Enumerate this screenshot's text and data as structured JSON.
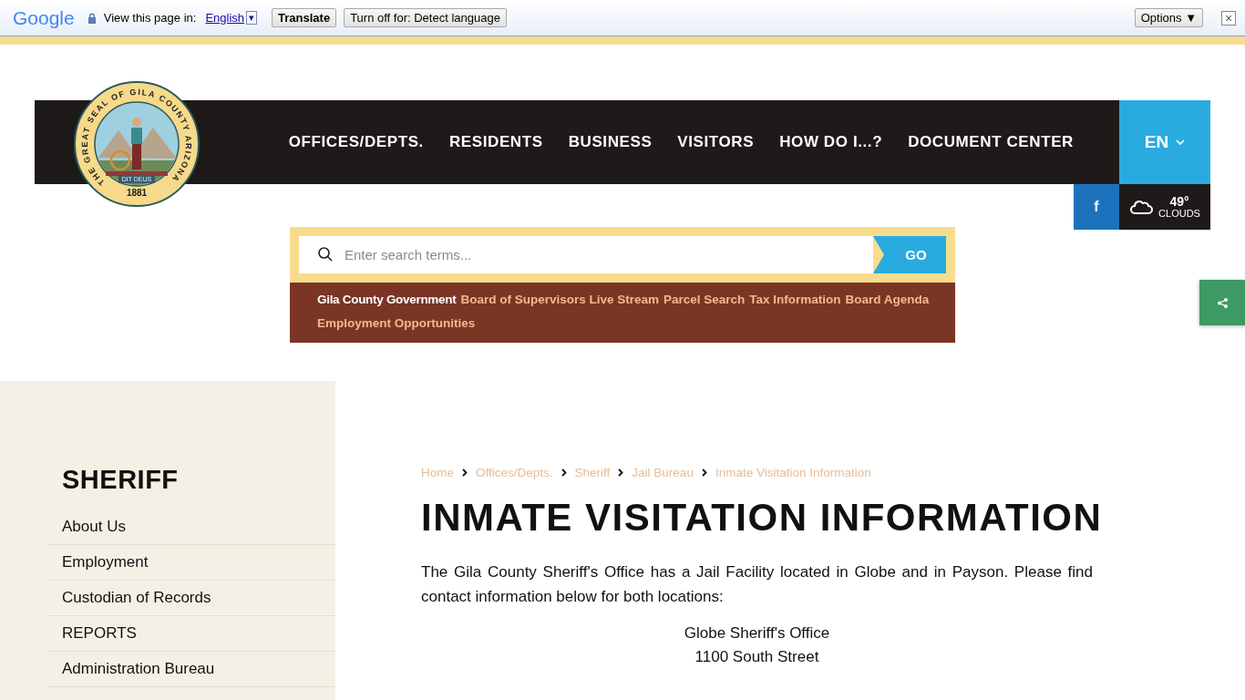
{
  "translate_bar": {
    "logo": "Google",
    "prompt": "View this page in:",
    "language": "English",
    "dropdown": "▾",
    "translate_button": "Translate",
    "turn_off_button": "Turn off for: Detect language",
    "options_button": "Options ▼",
    "close": "×"
  },
  "seal": {
    "ring_text": "THE GREAT SEAL OF GILA COUNTY ARIZONA",
    "motto": "DIT DEUS",
    "year": "1881"
  },
  "nav": {
    "items": [
      "OFFICES/DEPTS.",
      "RESIDENTS",
      "BUSINESS",
      "VISITORS",
      "HOW DO I...?",
      "DOCUMENT CENTER"
    ],
    "language": "EN"
  },
  "social": {
    "facebook": "f"
  },
  "weather": {
    "temperature": "49°",
    "condition": "CLOUDS"
  },
  "search": {
    "placeholder": "Enter search terms...",
    "button": "GO"
  },
  "quick_links": {
    "title": "Gila County Government",
    "links": [
      "Board of Supervisors Live Stream",
      "Parcel Search",
      "Tax Information",
      "Board Agenda",
      "Employment Opportunities"
    ]
  },
  "sidebar": {
    "title": "SHERIFF",
    "items": [
      "About Us",
      "Employment",
      "Custodian of Records",
      "REPORTS",
      "Administration Bureau"
    ]
  },
  "breadcrumb": [
    "Home",
    "Offices/Depts.",
    "Sheriff",
    "Jail Bureau",
    "Inmate Visitation Information"
  ],
  "page": {
    "title": "INMATE VISITATION INFORMATION",
    "intro": "The Gila County Sheriff's Office has a Jail Facility located in Globe and in Payson. Please find contact information below for both locations:",
    "address_lines": [
      "Globe Sheriff's Office",
      "1100 South Street"
    ]
  }
}
